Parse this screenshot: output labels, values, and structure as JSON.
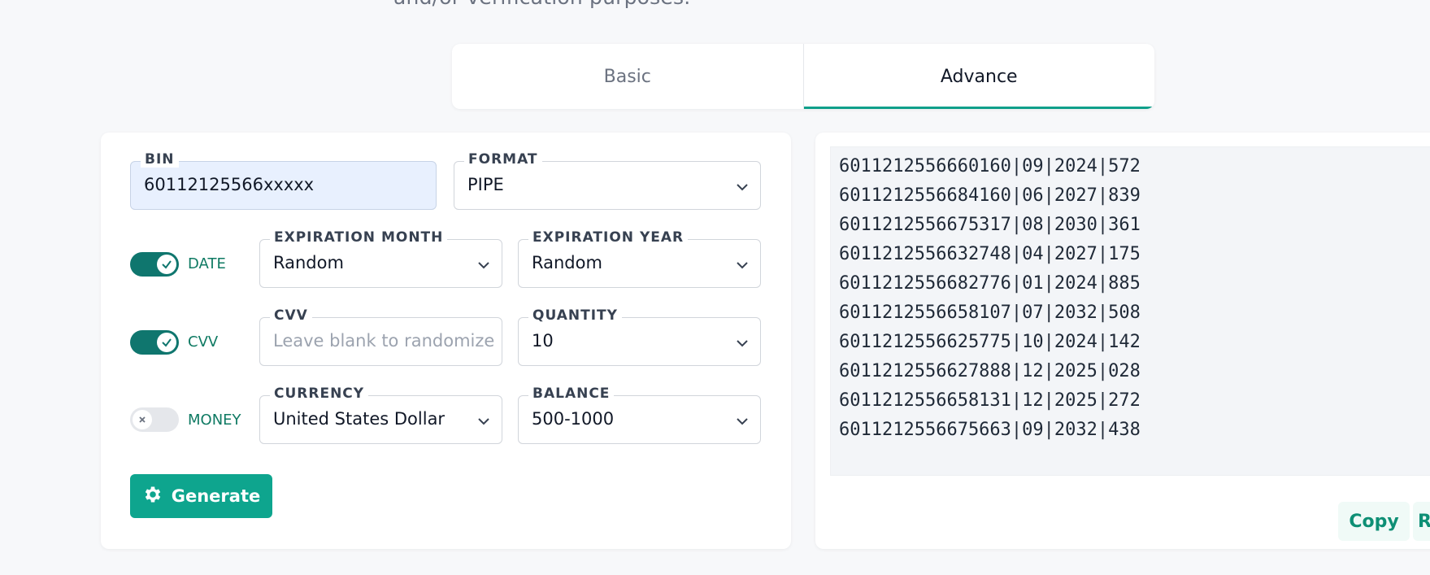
{
  "header": {
    "partial_text": "and/or verification purposes."
  },
  "tabs": [
    {
      "label": "Basic",
      "active": false
    },
    {
      "label": "Advance",
      "active": true
    }
  ],
  "form": {
    "bin": {
      "label": "BIN",
      "value": "60112125566xxxxx"
    },
    "format": {
      "label": "FORMAT",
      "value": "PIPE"
    },
    "date_toggle": {
      "label": "DATE",
      "on": true
    },
    "exp_month": {
      "label": "EXPIRATION MONTH",
      "value": "Random"
    },
    "exp_year": {
      "label": "EXPIRATION YEAR",
      "value": "Random"
    },
    "cvv_toggle": {
      "label": "CVV",
      "on": true
    },
    "cvv": {
      "label": "CVV",
      "placeholder": "Leave blank to randomize"
    },
    "quantity": {
      "label": "QUANTITY",
      "value": "10"
    },
    "money_toggle": {
      "label": "MONEY",
      "on": false
    },
    "currency": {
      "label": "CURRENCY",
      "value": "United States Dollar"
    },
    "balance": {
      "label": "BALANCE",
      "value": "500-1000"
    },
    "generate_label": "Generate"
  },
  "output": {
    "lines": [
      "6011212556660160|09|2024|572",
      "6011212556684160|06|2027|839",
      "6011212556675317|08|2030|361",
      "6011212556632748|04|2027|175",
      "6011212556682776|01|2024|885",
      "6011212556658107|07|2032|508",
      "6011212556625775|10|2024|142",
      "6011212556627888|12|2025|028",
      "6011212556658131|12|2025|272",
      "6011212556675663|09|2032|438"
    ],
    "copy_label": "Copy",
    "next_label": "R"
  },
  "colors": {
    "accent": "#0ea58e",
    "toggle_on": "#0f766e",
    "label_green": "#0f7a63",
    "bg": "#f7f8fa"
  },
  "icons": {
    "chevron": "chevron-down-icon",
    "check": "check-icon",
    "x": "close-icon",
    "gear": "gear-icon"
  }
}
